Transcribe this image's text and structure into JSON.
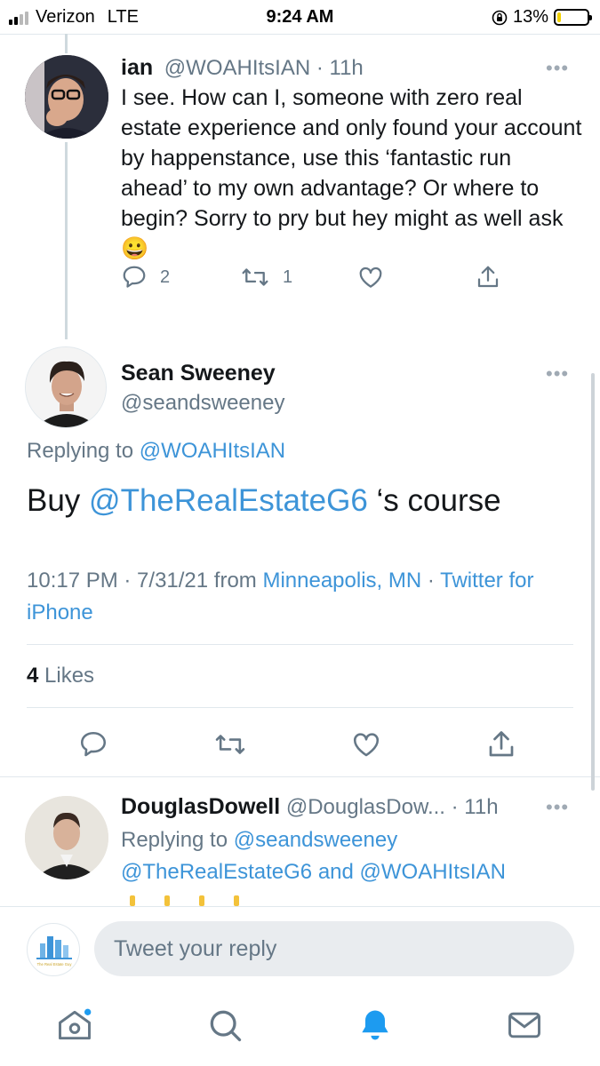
{
  "status_bar": {
    "carrier": "Verizon",
    "network": "LTE",
    "time": "9:24 AM",
    "battery": "13%",
    "battery_level": 0.13
  },
  "parent_tweet": {
    "display_name": "ian",
    "handle": "@WOAHItsIAN",
    "age": "· 11h",
    "text": "I see. How can I, someone with zero real estate experience and only found your account by happenstance, use this ‘fantastic run ahead’ to my own advantage? Or where to begin? Sorry to pry but hey might as well ask 😀",
    "reply_count": "2",
    "retweet_count": "1",
    "more": "•••"
  },
  "focused_tweet": {
    "display_name": "Sean Sweeney",
    "handle": "@seandsweeney",
    "replying_prefix": "Replying to",
    "replying_to": "@WOAHItsIAN",
    "text_before": "Buy ",
    "mention": "@TheRealEstateG6",
    "text_after": " ‘s course",
    "timestamp": "10:17 PM · 7/31/21 from",
    "location": "Minneapolis, MN",
    "separator": "·",
    "source": "Twitter for iPhone",
    "likes_count": "4",
    "likes_label": "Likes",
    "more": "•••"
  },
  "reply_tweet": {
    "display_name": "DouglasDowell",
    "handle": "@DouglasDow...",
    "age": "· 11h",
    "replying_prefix": "Replying to",
    "replying_to": "@seandsweeney",
    "replying_to_2": "@TheRealEstateG6",
    "and_label": "and",
    "replying_to_3": "@WOAHItsIAN",
    "more": "•••"
  },
  "composer": {
    "placeholder": "Tweet your reply",
    "avatar_caption": "The Real Estate Guy"
  },
  "tabbar": {
    "items": [
      "home-icon",
      "search-icon",
      "notifications-icon",
      "messages-icon"
    ],
    "active": "notifications-icon"
  },
  "colors": {
    "link": "#3d94d8",
    "muted": "#657786",
    "accent": "#1d9bf0"
  }
}
